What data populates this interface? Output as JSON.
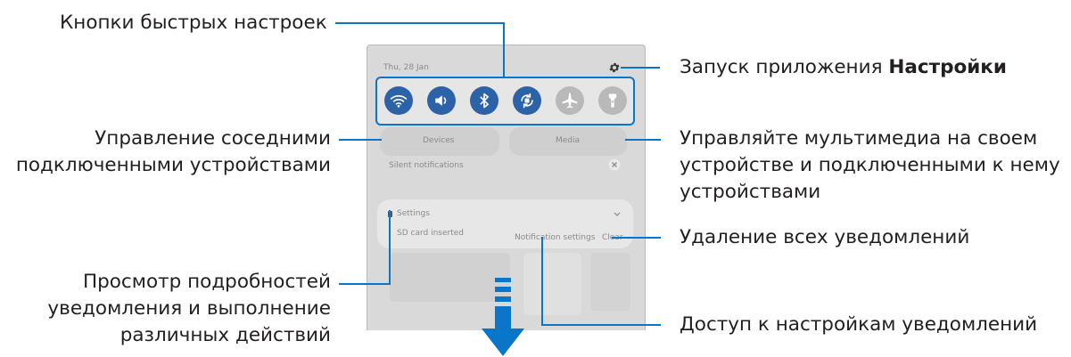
{
  "labels": {
    "quick_settings": "Кнопки быстрых настроек",
    "launch_settings_prefix": "Запуск приложения ",
    "launch_settings_bold": "Настройки",
    "nearby_line1": "Управление соседними",
    "nearby_line2": "подключенными устройствами",
    "media_line1": "Управляйте мультимедиа на своем",
    "media_line2": "устройстве и подключенными к нему",
    "media_line3": "устройствами",
    "clear_all": "Удаление всех уведомлений",
    "details_line1": "Просмотр подробностей",
    "details_line2": "уведомления и выполнение",
    "details_line3": "различных действий",
    "notif_settings": "Доступ к настройкам уведомлений"
  },
  "panel": {
    "date": "Thu, 28 Jan",
    "devices_label": "Devices",
    "media_label": "Media",
    "silent_notifications": "Silent notifications",
    "notification_app": "Settings",
    "notification_text": "SD card inserted",
    "notification_settings_button": "Notification settings",
    "clear_button": "Clear"
  },
  "quick_buttons": [
    {
      "icon": "wifi-icon",
      "state": "on"
    },
    {
      "icon": "sound-icon",
      "state": "on"
    },
    {
      "icon": "bluetooth-icon",
      "state": "on"
    },
    {
      "icon": "auto-rotate-icon",
      "state": "on"
    },
    {
      "icon": "airplane-mode-icon",
      "state": "off"
    },
    {
      "icon": "flashlight-icon",
      "state": "off"
    }
  ],
  "colors": {
    "accent": "#0a76c8",
    "button_on": "#2c62a8",
    "button_off": "#b9b9b9",
    "panel_bg": "#d9d9d9"
  }
}
